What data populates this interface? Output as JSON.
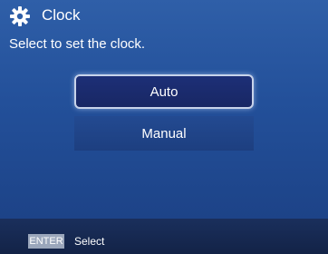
{
  "header": {
    "icon": "gear-icon",
    "title": "Clock",
    "subtitle": "Select to set the clock."
  },
  "options": {
    "auto": "Auto",
    "manual": "Manual",
    "selected": "Auto"
  },
  "footer": {
    "key_label": "ENTER",
    "action_label": "Select"
  },
  "colors": {
    "background": "#2a5aa4",
    "selected_button": "#1d2f77",
    "footer": "#1a2f5c",
    "key_badge": "#9aa6bb"
  }
}
